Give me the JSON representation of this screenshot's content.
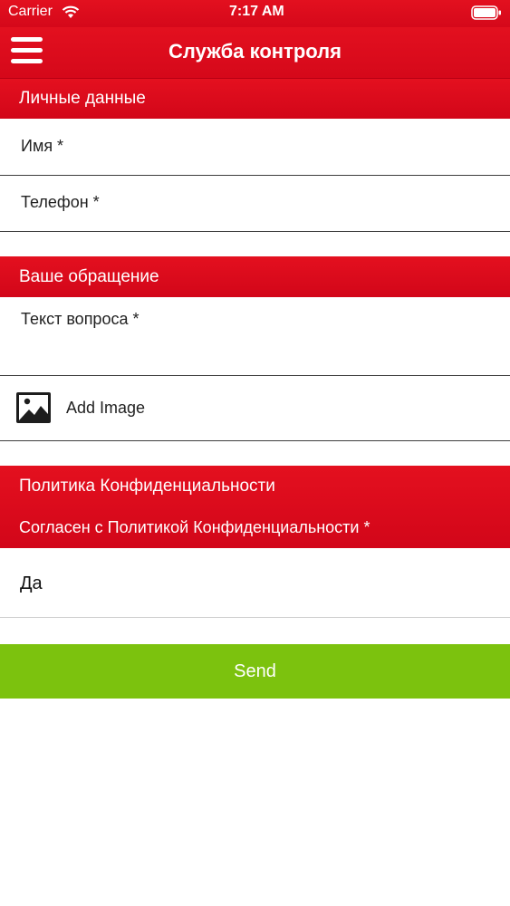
{
  "status_bar": {
    "carrier": "Carrier",
    "time": "7:17 AM"
  },
  "header": {
    "title": "Служба контроля",
    "menu_icon": "hamburger-menu-icon"
  },
  "personal": {
    "title": "Личные данные",
    "name_placeholder": "Имя *",
    "phone_placeholder": "Телефон *"
  },
  "request": {
    "title": "Ваше обращение",
    "question_placeholder": "Текст вопроса *",
    "add_image_label": "Add Image",
    "image_icon": "image-icon"
  },
  "privacy": {
    "title": "Политика Конфиденциальности",
    "agree_label": "Согласен с Политикой Конфиденциальности *",
    "selected_value": "Да"
  },
  "actions": {
    "send_label": "Send"
  },
  "colors": {
    "brand_red": "#d90a1c",
    "send_green": "#7cc20e"
  }
}
